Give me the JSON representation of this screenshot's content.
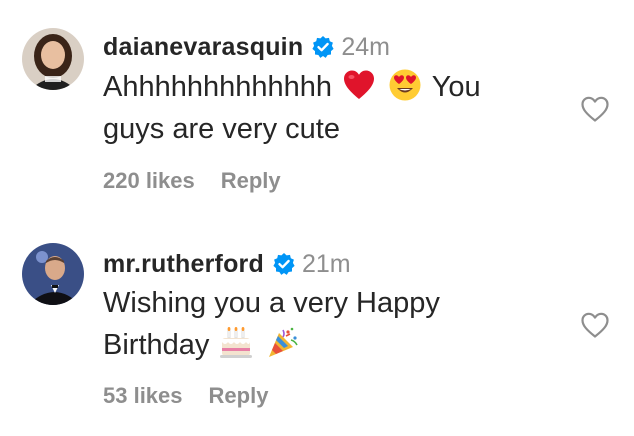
{
  "comments": [
    {
      "username": "daianevarasquin",
      "verified": true,
      "time": "24m",
      "text_line1_before": "Ahhhhhhhhhhhhh",
      "text_line1_after": "You",
      "text_line2": "guys are very cute",
      "emojis": [
        "red-heart",
        "heart-eyes-face"
      ],
      "likes": "220 likes",
      "reply_label": "Reply"
    },
    {
      "username": "mr.rutherford",
      "verified": true,
      "time": "21m",
      "text_line1": "Wishing you a very Happy",
      "text_line2": "Birthday",
      "emojis": [
        "birthday-cake",
        "party-popper"
      ],
      "likes": "53 likes",
      "reply_label": "Reply"
    }
  ],
  "colors": {
    "text": "#262626",
    "secondary": "#8e8e8e",
    "verified_blue": "#0095f6",
    "heart_outline": "#8e8e8e"
  },
  "icons": {
    "verified": "verified-badge-icon",
    "like": "heart-outline-icon"
  }
}
